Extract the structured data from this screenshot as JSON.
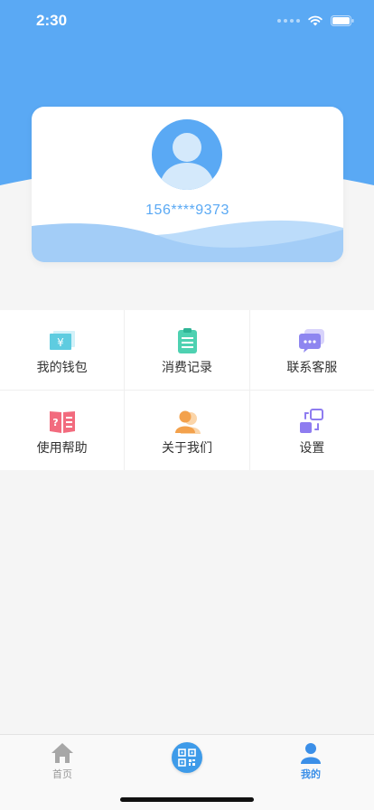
{
  "status_bar": {
    "time": "2:30"
  },
  "profile": {
    "phone": "156****9373"
  },
  "menu": [
    {
      "label": "我的钱包",
      "icon": "wallet-icon"
    },
    {
      "label": "消费记录",
      "icon": "clipboard-icon"
    },
    {
      "label": "联系客服",
      "icon": "chat-icon"
    },
    {
      "label": "使用帮助",
      "icon": "help-book-icon"
    },
    {
      "label": "关于我们",
      "icon": "person-icon"
    },
    {
      "label": "设置",
      "icon": "settings-icon"
    }
  ],
  "tab_bar": {
    "home_label": "首页",
    "mine_label": "我的",
    "active": "我的"
  },
  "colors": {
    "primary": "#5aa9f4",
    "active_tab": "#3b8fe8",
    "background": "#f5f5f5"
  }
}
